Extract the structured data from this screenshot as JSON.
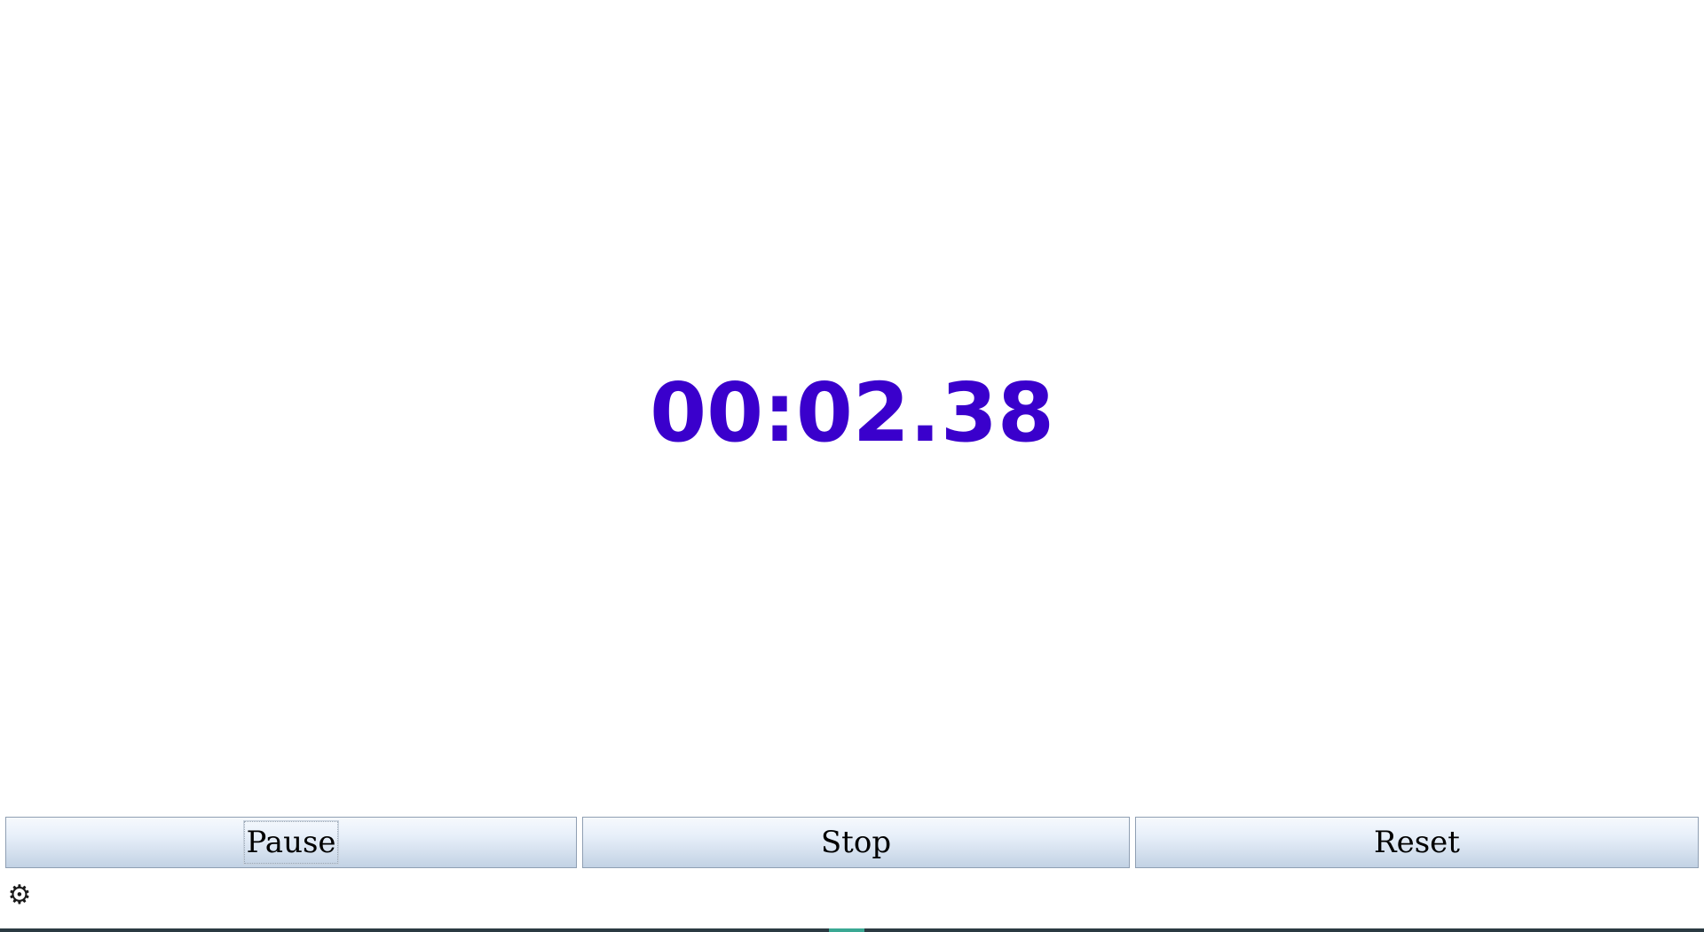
{
  "timer": {
    "display": "00:02.38",
    "color": "#3a00cc"
  },
  "controls": {
    "pause_label": "Pause",
    "stop_label": "Stop",
    "reset_label": "Reset"
  },
  "settings": {
    "icon": "gear-icon",
    "glyph": "⚙"
  }
}
